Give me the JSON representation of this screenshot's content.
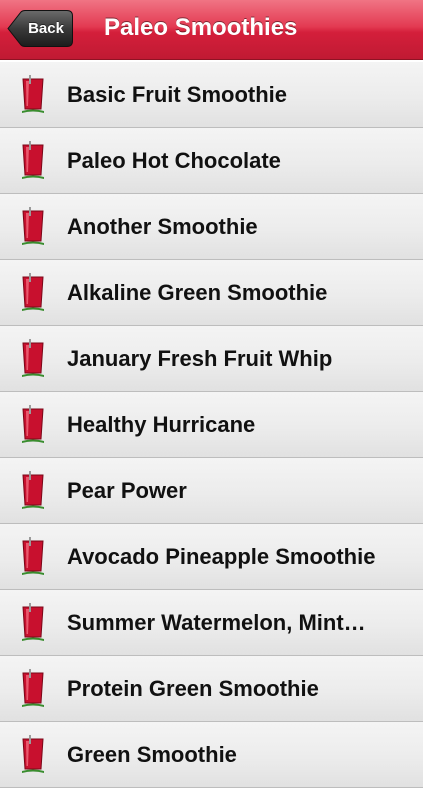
{
  "navbar": {
    "back_label": "Back",
    "title": "Paleo Smoothies",
    "color": "#d8233f"
  },
  "list": {
    "icon": "smoothie-glass-icon",
    "icon_color": "#c8102e",
    "items": [
      {
        "label": "Basic Fruit Smoothie"
      },
      {
        "label": "Paleo Hot Chocolate"
      },
      {
        "label": "Another Smoothie"
      },
      {
        "label": "Alkaline Green Smoothie"
      },
      {
        "label": "January Fresh Fruit Whip"
      },
      {
        "label": "Healthy Hurricane"
      },
      {
        "label": "Pear Power"
      },
      {
        "label": "Avocado Pineapple Smoothie"
      },
      {
        "label": "Summer Watermelon, Mint…"
      },
      {
        "label": "Protein Green Smoothie"
      },
      {
        "label": "Green Smoothie"
      }
    ]
  }
}
